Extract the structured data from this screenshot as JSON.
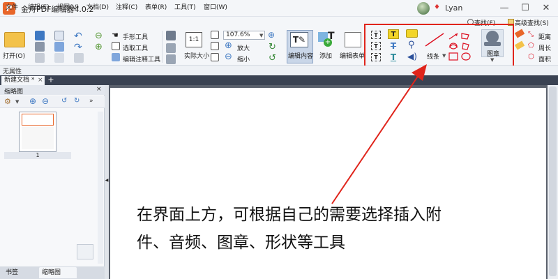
{
  "window": {
    "app_logo": "P",
    "title": "金舟PDF编辑器4.0.2",
    "user_name": "Lyan",
    "minimize": "—",
    "restore": "☐",
    "close": "✕"
  },
  "menu": {
    "items": [
      "文件",
      "编辑(E)",
      "视图(V)",
      "文档(D)",
      "注释(C)",
      "表单(R)",
      "工具(T)",
      "窗口(W)"
    ],
    "find": "查找(F)",
    "advanced_find": "高级查找(S)"
  },
  "toolbar": {
    "open": "打开(O)",
    "hand_tool": "手形工具",
    "select_tool": "选取工具",
    "edit_annotation_tool": "编辑注释工具",
    "actual_size": "实际大小",
    "zoom_value": "107.6%",
    "zoom_in": "放大",
    "zoom_out": "缩小",
    "edit_content": "编辑内容",
    "add": "添加",
    "edit_form": "编辑表单",
    "line": "线条",
    "stamp": "图章",
    "distance": "距离",
    "perimeter": "周长",
    "area": "面积"
  },
  "subbar": {
    "no_properties": "无属性"
  },
  "tabs": {
    "document_tab": "新建文档 *",
    "close": "×",
    "new_tab": "+"
  },
  "left_panel": {
    "title": "缩略图",
    "close": "×",
    "page_number": "1",
    "bottom_tabs": [
      "书签",
      "缩略图"
    ]
  },
  "document": {
    "annotation_line1": "在界面上方，可根据自己的需要选择插入附",
    "annotation_line2": "件、音频、图章、形状等工具"
  },
  "colors": {
    "highlight": "#e0241b",
    "brand": "#e8662a"
  }
}
